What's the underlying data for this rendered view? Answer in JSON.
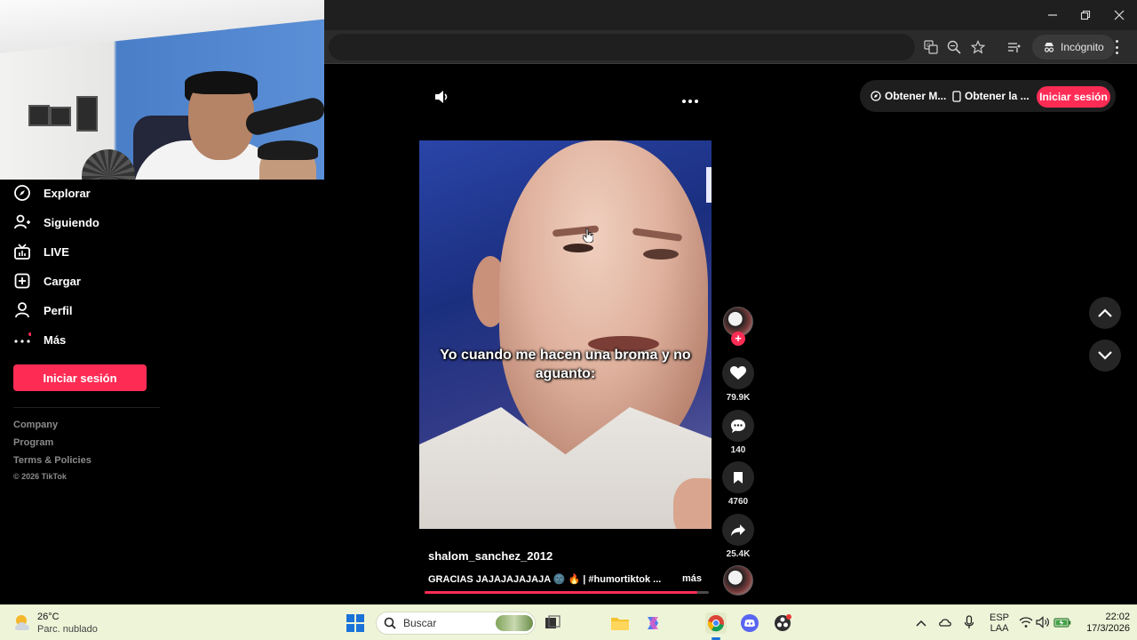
{
  "browser": {
    "incognito_label": "Incógnito"
  },
  "sidebar": {
    "items": [
      {
        "label": "Explorar"
      },
      {
        "label": "Siguiendo"
      },
      {
        "label": "LIVE"
      },
      {
        "label": "Cargar"
      },
      {
        "label": "Perfil"
      },
      {
        "label": "Más"
      }
    ],
    "login_button": "Iniciar sesión",
    "footer": [
      "Company",
      "Program",
      "Terms & Policies"
    ],
    "copyright": "© 2026 TikTok"
  },
  "top_bar": {
    "get_app_1": "Obtener M...",
    "get_app_2": "Obtener la ...",
    "login_button": "Iniciar sesión"
  },
  "video": {
    "caption": "Yo cuando me hacen una broma y no aguanto:",
    "author": "shalom_sanchez_2012",
    "description": "GRACIAS JAJAJAJAJAJA 🌚 🔥 | #humortiktok ...",
    "more_label": "más",
    "progress_fraction": 0.96
  },
  "actions": {
    "likes": "79.9K",
    "comments": "140",
    "saves": "4760",
    "shares": "25.4K"
  },
  "taskbar": {
    "temperature": "26°C",
    "weather": "Parc. nublado",
    "search_placeholder": "Buscar",
    "lang_1": "ESP",
    "lang_2": "LAA",
    "time": "22:02",
    "date": "17/3/2026"
  },
  "colors": {
    "accent": "#fe2c55",
    "background": "#000000",
    "taskbar": "#eef4d8"
  }
}
